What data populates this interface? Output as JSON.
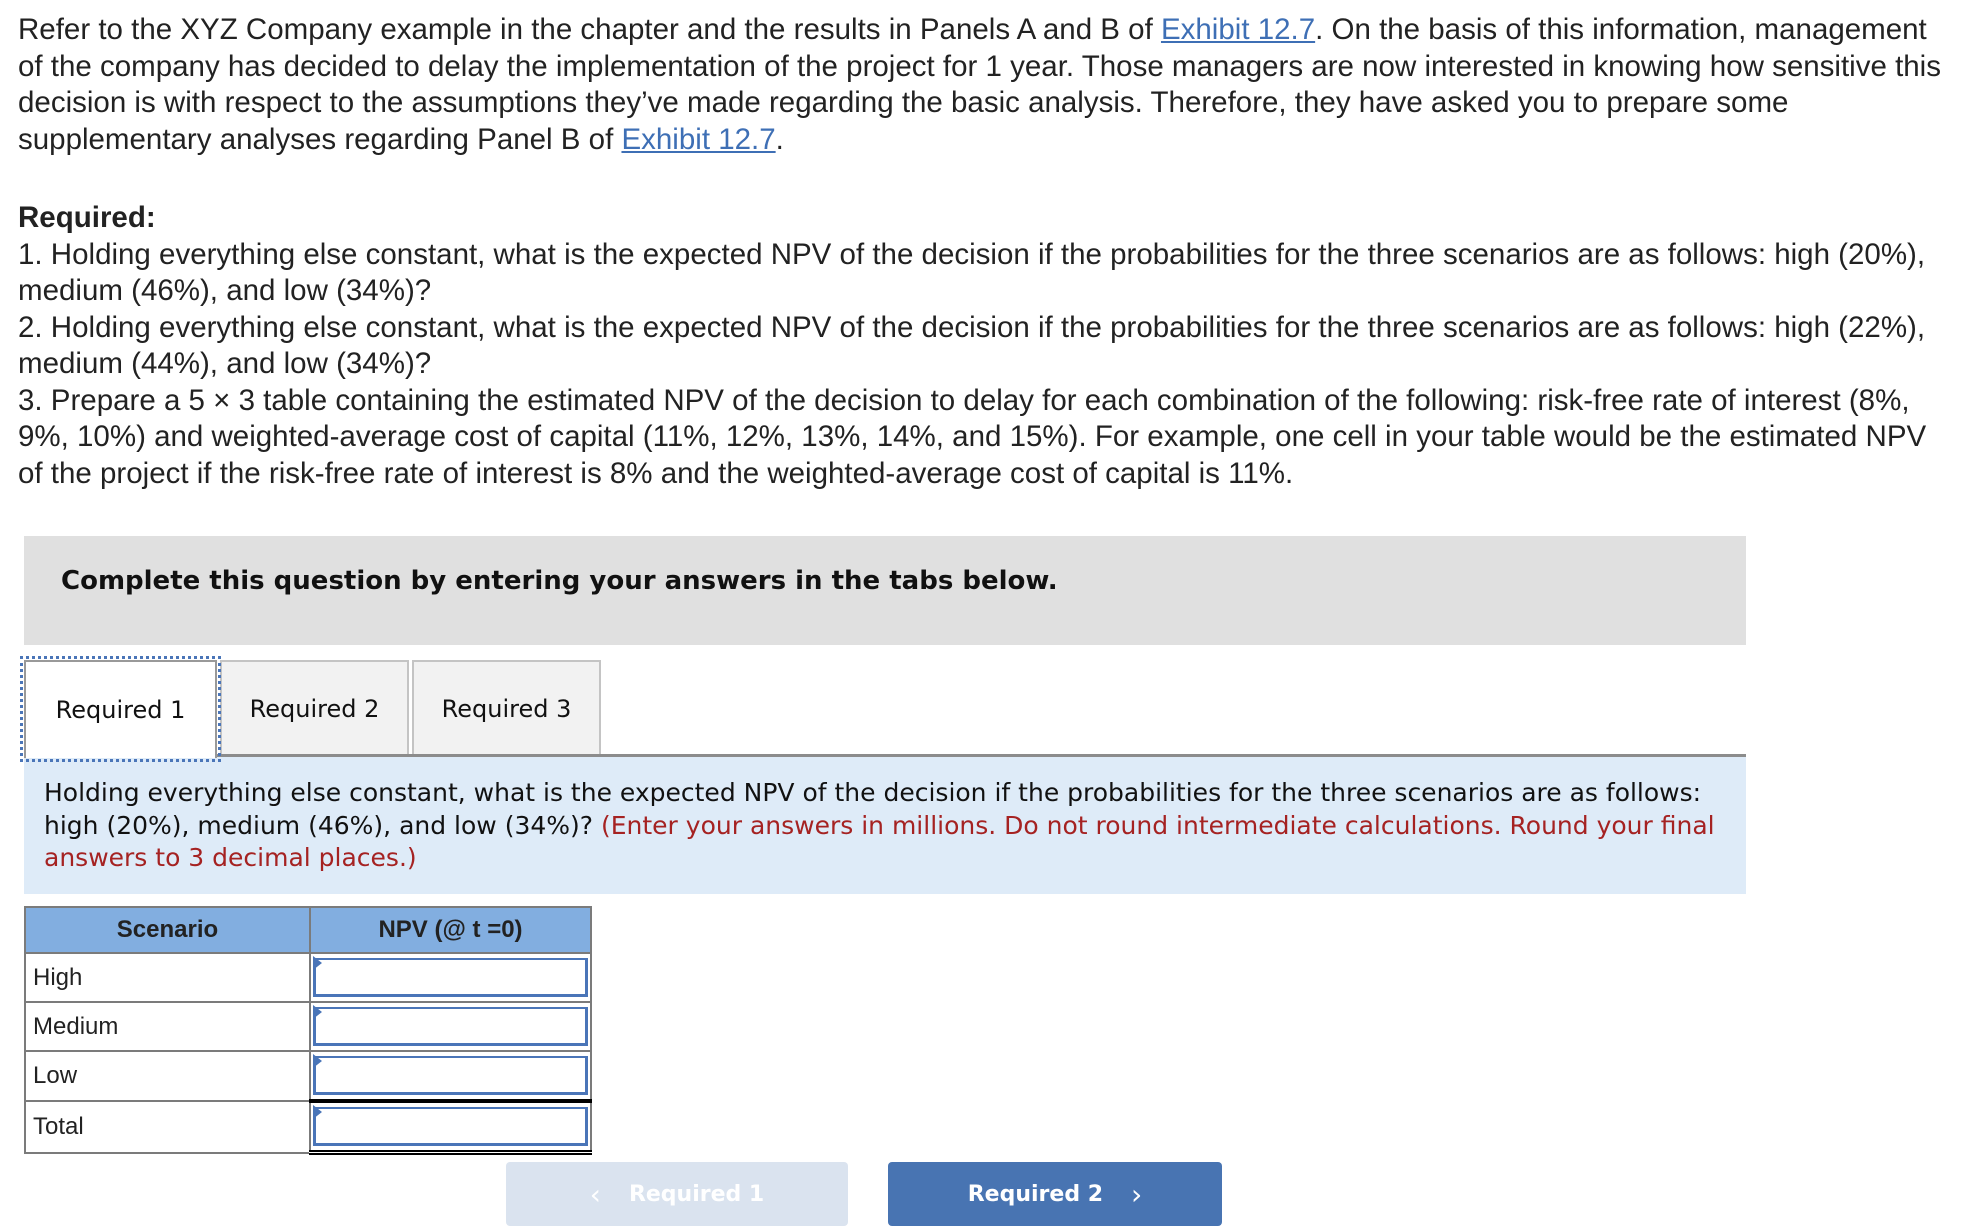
{
  "intro": {
    "part1": "Refer to the XYZ Company example in the chapter and the results in Panels A and B of ",
    "link1": "Exhibit 12.7",
    "part2": ". On the basis of this information, management of the company has decided to delay the implementation of the project for 1 year. Those managers are now interested in knowing how sensitive this decision is with respect to the assumptions they’ve made regarding the basic analysis. Therefore, they have asked you to prepare some supplementary analyses regarding Panel B of ",
    "link2": "Exhibit 12.7",
    "part3": "."
  },
  "required": {
    "title": "Required:",
    "items": [
      "1. Holding everything else constant, what is the expected NPV of the decision if the probabilities for the three scenarios are as follows: high (20%), medium (46%), and low (34%)?",
      "2. Holding everything else constant, what is the expected NPV of the decision if the probabilities for the three scenarios are as follows: high (22%), medium (44%), and low (34%)?",
      "3. Prepare a 5 × 3 table containing the estimated NPV of the decision to delay for each combination of the following: risk-free rate of interest (8%, 9%, 10%) and weighted-average cost of capital (11%, 12%, 13%, 14%, and 15%). For example, one cell in your table would be the estimated NPV of the project if the risk-free rate of interest is 8% and the weighted-average cost of capital is 11%."
    ]
  },
  "banner": "Complete this question by entering your answers in the tabs below.",
  "tabs": [
    {
      "label": "Required 1",
      "active": true
    },
    {
      "label": "Required 2",
      "active": false
    },
    {
      "label": "Required 3",
      "active": false
    }
  ],
  "instructions": {
    "question": "Holding everything else constant, what is the expected NPV of the decision if the probabilities for the three scenarios are as follows: high (20%), medium (46%), and low (34%)? ",
    "note": "(Enter your answers in millions. Do not round intermediate calculations. Round your final answers to 3 decimal places.)"
  },
  "table": {
    "headers": [
      "Scenario",
      "NPV (@ t =0)"
    ],
    "rows": [
      {
        "label": "High",
        "value": ""
      },
      {
        "label": "Medium",
        "value": ""
      },
      {
        "label": "Low",
        "value": ""
      },
      {
        "label": "Total",
        "value": ""
      }
    ]
  },
  "nav": {
    "prev_label": "Required 1",
    "next_label": "Required 2",
    "prev_icon": "chevron-left-icon",
    "next_icon": "chevron-right-icon",
    "prev_disabled": true
  },
  "colors": {
    "link": "#3e6fb5",
    "tab_focus": "#4a75b8",
    "instructions_bg": "#deebf8",
    "note_red": "#a52222",
    "table_header_bg": "#82aee0",
    "next_button_bg": "#4874b2",
    "prev_button_bg": "#dae3ef"
  }
}
